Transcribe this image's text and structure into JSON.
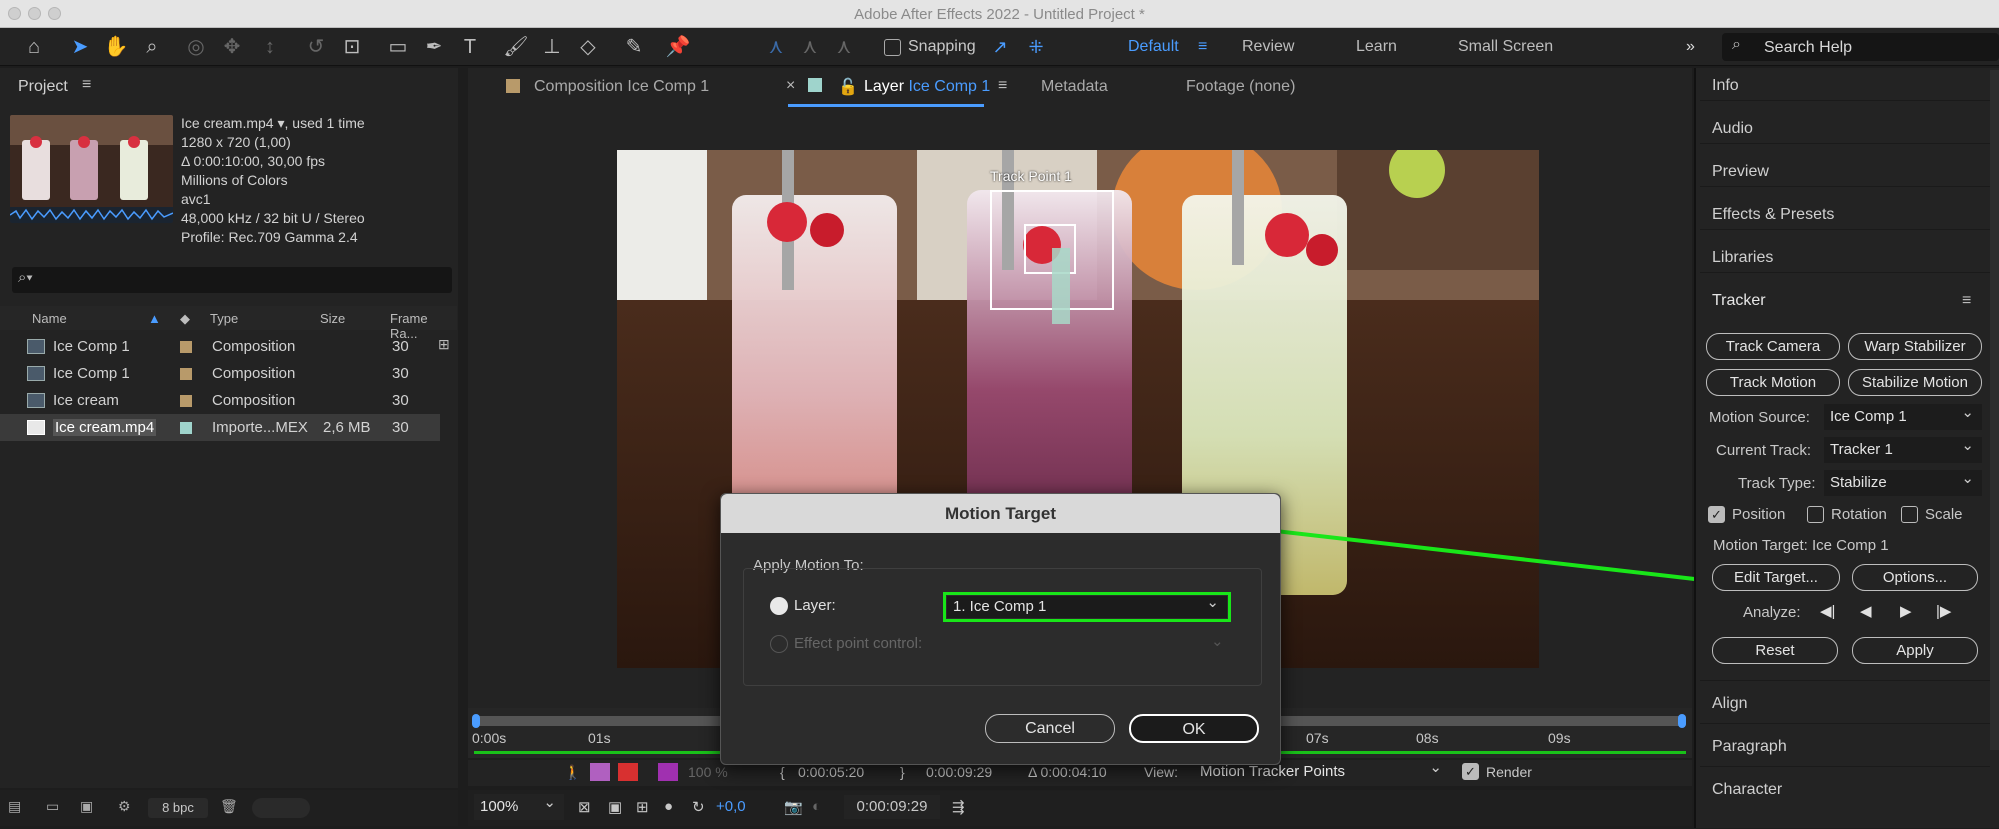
{
  "app": {
    "title": "Adobe After Effects 2022 - Untitled Project *"
  },
  "toolbar": {
    "snapping_label": "Snapping",
    "workspaces": [
      "Default",
      "Review",
      "Learn",
      "Small Screen"
    ],
    "search_placeholder": "Search Help"
  },
  "project": {
    "panel_label": "Project",
    "footage_name": "Ice cream.mp4",
    "footage_usage": ", used 1 time",
    "info_lines": [
      "1280 x 720 (1,00)",
      "Δ 0:00:10:00, 30,00 fps",
      "Millions of Colors",
      "avc1",
      "48,000 kHz / 32 bit U / Stereo",
      "Profile: Rec.709 Gamma 2.4"
    ],
    "columns": {
      "name": "Name",
      "type": "Type",
      "size": "Size",
      "frame_rate": "Frame Ra..."
    },
    "items": [
      {
        "name": "Ice Comp 1",
        "type": "Composition",
        "size": "",
        "fps": "30",
        "swatch": "#b89a6a"
      },
      {
        "name": "Ice Comp 1",
        "type": "Composition",
        "size": "",
        "fps": "30",
        "swatch": "#b89a6a"
      },
      {
        "name": "Ice cream",
        "type": "Composition",
        "size": "",
        "fps": "30",
        "swatch": "#b89a6a"
      },
      {
        "name": "Ice cream.mp4",
        "type": "Importe...MEX",
        "size": "2,6 MB",
        "fps": "30",
        "swatch": "#9fd4cc"
      }
    ],
    "bpc": "8 bpc"
  },
  "viewer_tabs": {
    "composition_prefix": "Composition",
    "composition_name": "Ice Comp 1",
    "layer_prefix": "Layer",
    "layer_name": "Ice Comp 1",
    "metadata": "Metadata",
    "footage": "Footage (none)"
  },
  "viewer": {
    "track_point_label": "Track Point 1",
    "time_ruler": [
      "0:00s",
      "01s",
      "07s",
      "08s",
      "09s"
    ],
    "current_time": "0:00:05:20",
    "out_point": "0:00:09:29",
    "duration": "Δ 0:00:04:10",
    "view_label": "View:",
    "view_value": "Motion Tracker Points",
    "render_label": "Render",
    "opacity_label": "100 %",
    "zoom": "100%",
    "exposure": "+0,0",
    "timecode": "0:00:09:29"
  },
  "dialog": {
    "title": "Motion Target",
    "group_label": "Apply Motion To:",
    "layer_label": "Layer:",
    "layer_value": "1. Ice Comp 1",
    "effect_label": "Effect point control:",
    "cancel": "Cancel",
    "ok": "OK"
  },
  "right_panel": {
    "top_items": [
      "Info",
      "Audio",
      "Preview",
      "Effects & Presets",
      "Libraries"
    ],
    "tracker": {
      "title": "Tracker",
      "track_camera": "Track Camera",
      "warp_stabilizer": "Warp Stabilizer",
      "track_motion": "Track Motion",
      "stabilize_motion": "Stabilize Motion",
      "motion_source_label": "Motion Source:",
      "motion_source_value": "Ice Comp 1",
      "current_track_label": "Current Track:",
      "current_track_value": "Tracker 1",
      "track_type_label": "Track Type:",
      "track_type_value": "Stabilize",
      "position_label": "Position",
      "rotation_label": "Rotation",
      "scale_label": "Scale",
      "motion_target": "Motion Target: Ice Comp 1",
      "edit_target": "Edit Target...",
      "options": "Options...",
      "analyze_label": "Analyze:",
      "reset": "Reset",
      "apply": "Apply"
    },
    "bottom_items": [
      "Align",
      "Paragraph",
      "Character"
    ]
  },
  "colors": {
    "accent_blue": "#4a9cff",
    "highlight_green": "#19e619",
    "panel_bg": "#232323"
  }
}
